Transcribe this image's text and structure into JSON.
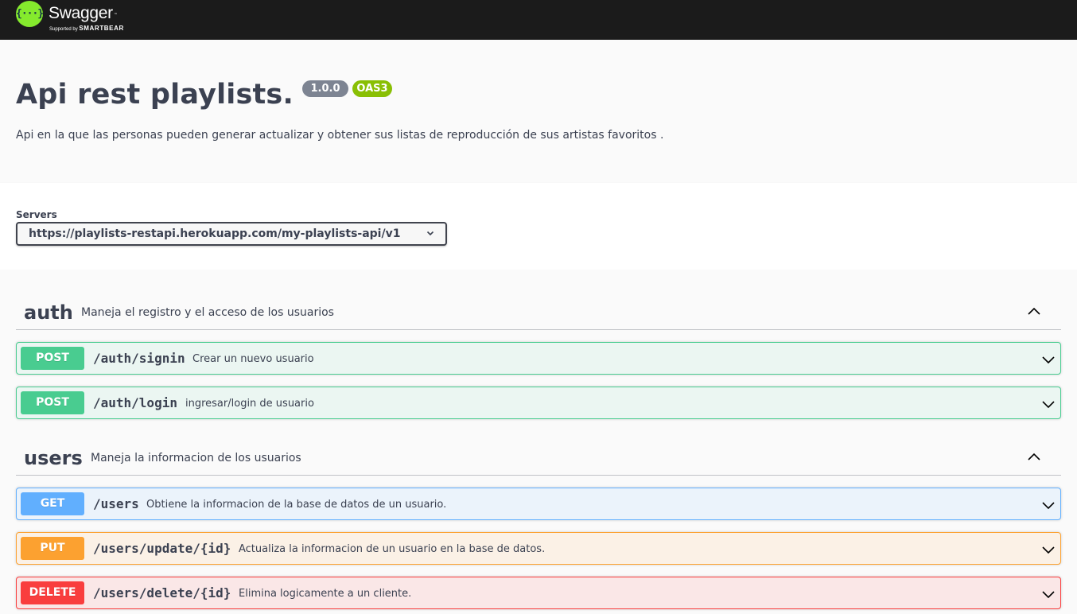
{
  "topbar": {
    "logo_glyph": "{···}",
    "logo_name": "Swagger",
    "logo_tm": "™",
    "logo_sub_prefix": "Supported by ",
    "logo_sub_brand": "SMARTBEAR"
  },
  "info": {
    "title": "Api rest playlists.",
    "version": "1.0.0",
    "spec": "OAS3",
    "description": "Api en la que las personas pueden generar actualizar y obtener sus listas de reproducción de sus artistas favoritos ."
  },
  "servers": {
    "label": "Servers",
    "selected": "https://playlists-restapi.herokuapp.com/my-playlists-api/v1"
  },
  "tags": [
    {
      "name": "auth",
      "description": "Maneja el registro y el acceso de los usuarios",
      "operations": [
        {
          "method": "POST",
          "path": "/auth/signin",
          "summary": "Crear un nuevo usuario"
        },
        {
          "method": "POST",
          "path": "/auth/login",
          "summary": "ingresar/login de usuario"
        }
      ]
    },
    {
      "name": "users",
      "description": "Maneja la informacion de los usuarios",
      "operations": [
        {
          "method": "GET",
          "path": "/users",
          "summary": "Obtiene la informacion de la base de datos de un usuario."
        },
        {
          "method": "PUT",
          "path": "/users/update/{id}",
          "summary": "Actualiza la informacion de un usuario en la base de datos."
        },
        {
          "method": "DELETE",
          "path": "/users/delete/{id}",
          "summary": "Elimina logicamente a un cliente."
        }
      ]
    }
  ],
  "colors": {
    "topbar": "#1b1b1b",
    "logo": "#85ea2d",
    "post": "#49cc90",
    "get": "#61affe",
    "put": "#fca130",
    "delete": "#f93e3e",
    "version_badge": "#7d8492",
    "oas_badge": "#89bf04"
  },
  "icons": {
    "server_dropdown": "chevron-down-icon",
    "tag_toggle": "chevron-up-icon",
    "operation_toggle": "chevron-down-icon"
  }
}
